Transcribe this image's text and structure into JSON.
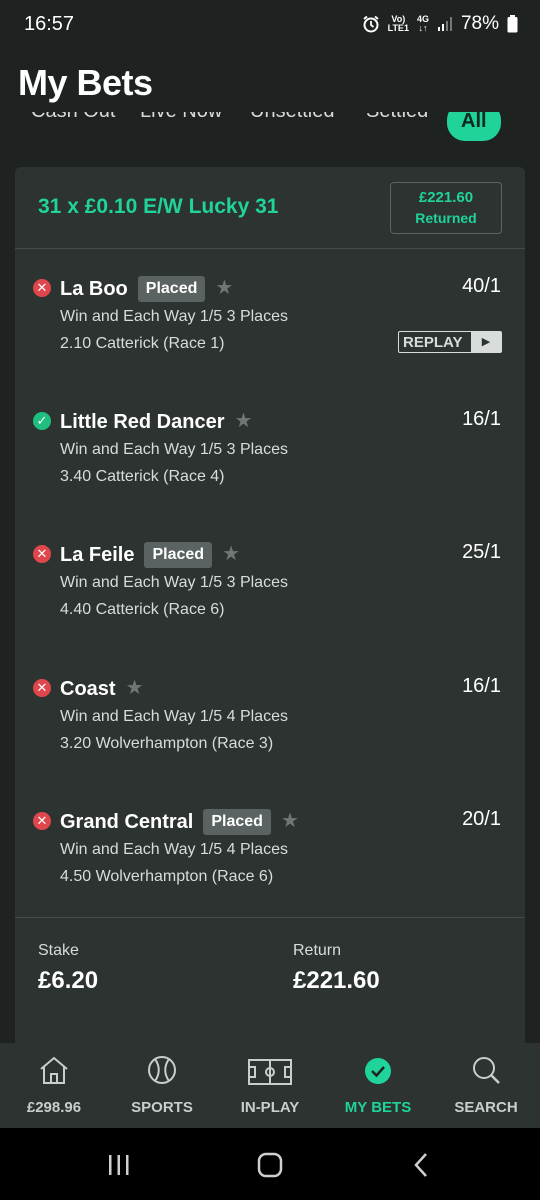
{
  "status_bar": {
    "time": "16:57",
    "network_top": "Vo)",
    "network_bottom": "LTE1",
    "signal_type": "4G",
    "battery": "78%",
    "icons": [
      "alarm-icon",
      "signal-icon",
      "battery-icon"
    ]
  },
  "page_title": "My Bets",
  "tabs": [
    {
      "label": "Cash Out",
      "active": false
    },
    {
      "label": "Live Now",
      "active": false
    },
    {
      "label": "Unsettled",
      "active": false
    },
    {
      "label": "Settled",
      "active": false
    },
    {
      "label": "All",
      "active": true
    }
  ],
  "bet": {
    "title": "31 x £0.10 E/W Lucky 31",
    "returned_amount": "£221.60",
    "returned_label": "Returned",
    "selections": [
      {
        "name": "La Boo",
        "badge": "Placed",
        "odds": "40/1",
        "market": "Win and Each Way 1/5 3 Places",
        "event": "2.10 Catterick (Race 1)",
        "result": "lost",
        "replay": "REPLAY"
      },
      {
        "name": "Little Red Dancer",
        "badge": "",
        "odds": "16/1",
        "market": "Win and Each Way 1/5 3 Places",
        "event": "3.40 Catterick (Race 4)",
        "result": "won"
      },
      {
        "name": "La Feile",
        "badge": "Placed",
        "odds": "25/1",
        "market": "Win and Each Way 1/5 3 Places",
        "event": "4.40 Catterick (Race 6)",
        "result": "lost"
      },
      {
        "name": "Coast",
        "badge": "",
        "odds": "16/1",
        "market": "Win and Each Way 1/5 4 Places",
        "event": "3.20 Wolverhampton (Race 3)",
        "result": "lost"
      },
      {
        "name": "Grand Central",
        "badge": "Placed",
        "odds": "20/1",
        "market": "Win and Each Way 1/5 4 Places",
        "event": "4.50 Wolverhampton (Race 6)",
        "result": "lost"
      }
    ],
    "stake_label": "Stake",
    "stake_value": "£6.20",
    "return_label": "Return",
    "return_value": "£221.60"
  },
  "bottom_nav": [
    {
      "label": "£298.96",
      "icon": "home-icon",
      "active": false
    },
    {
      "label": "SPORTS",
      "icon": "ball-icon",
      "active": false
    },
    {
      "label": "IN-PLAY",
      "icon": "pitch-icon",
      "active": false
    },
    {
      "label": "MY BETS",
      "icon": "check-circle-icon",
      "active": true
    },
    {
      "label": "SEARCH",
      "icon": "search-icon",
      "active": false
    }
  ],
  "colors": {
    "accent": "#1fd39a",
    "background": "#1e2322",
    "card": "#2c3331",
    "lost": "#e0474c",
    "won": "#1fbf7f"
  }
}
